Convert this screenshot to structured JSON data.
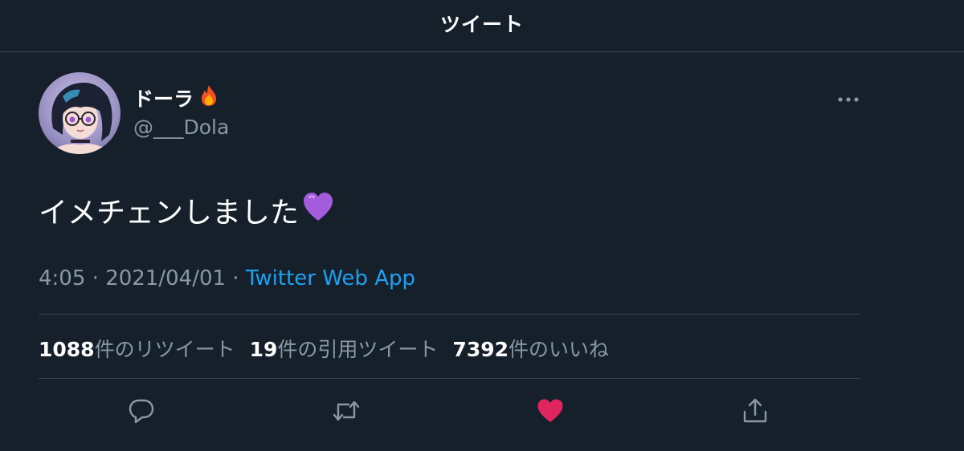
{
  "header": {
    "title": "ツイート"
  },
  "user": {
    "display_name": "ドーラ",
    "name_emoji": "fire",
    "handle": "@___Dola"
  },
  "tweet": {
    "text": "イメチェンしました",
    "text_emoji": "purple-heart",
    "time": "4:05",
    "separator": " · ",
    "date": "2021/04/01",
    "source": "Twitter Web App"
  },
  "stats": {
    "retweets_count": "1088",
    "retweets_label": "件のリツイート",
    "quotes_count": "19",
    "quotes_label": "件の引用ツイート",
    "likes_count": "7392",
    "likes_label": "件のいいね"
  },
  "actions": [
    {
      "icon": "reply-icon"
    },
    {
      "icon": "retweet-icon"
    },
    {
      "icon": "like-icon",
      "active": true
    },
    {
      "icon": "share-icon"
    }
  ],
  "colors": {
    "background": "#15202b",
    "divider": "#38444d",
    "secondary_text": "#8899a6",
    "link": "#1da1f2",
    "like_active": "#e0245e"
  }
}
